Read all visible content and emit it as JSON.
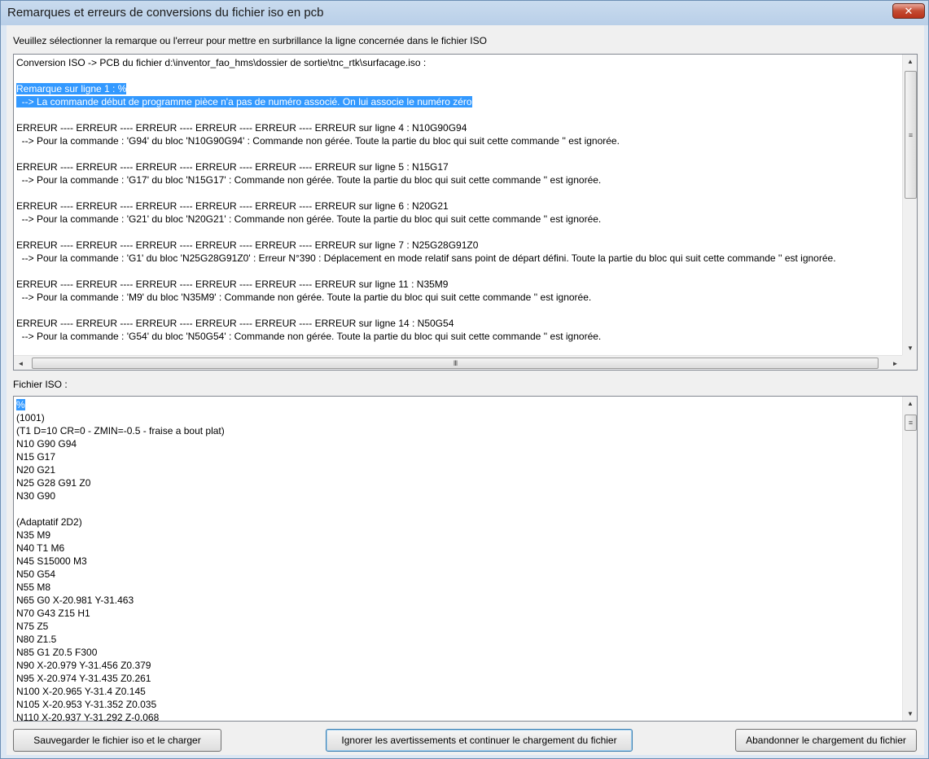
{
  "window": {
    "title": "Remarques et erreurs de conversions du fichier iso en pcb",
    "close_glyph": "✕"
  },
  "instruction": "Veuillez sélectionner la remarque ou l'erreur pour mettre en surbrillance la ligne concernée dans le fichier ISO",
  "messages": {
    "lines": [
      "Conversion ISO -> PCB du fichier d:\\inventor_fao_hms\\dossier de sortie\\tnc_rtk\\surfacage.iso :",
      "",
      "Remarque sur ligne 1 : %",
      "  --> La commande début de programme pièce n'a pas de numéro associé. On lui associe le numéro zéro",
      "",
      "ERREUR ---- ERREUR ---- ERREUR ---- ERREUR ---- ERREUR ---- ERREUR sur ligne 4 : N10G90G94",
      "  --> Pour la commande : 'G94' du bloc 'N10G90G94' : Commande non gérée. Toute la partie du bloc qui suit cette commande '' est ignorée.",
      "",
      "ERREUR ---- ERREUR ---- ERREUR ---- ERREUR ---- ERREUR ---- ERREUR sur ligne 5 : N15G17",
      "  --> Pour la commande : 'G17' du bloc 'N15G17' : Commande non gérée. Toute la partie du bloc qui suit cette commande '' est ignorée.",
      "",
      "ERREUR ---- ERREUR ---- ERREUR ---- ERREUR ---- ERREUR ---- ERREUR sur ligne 6 : N20G21",
      "  --> Pour la commande : 'G21' du bloc 'N20G21' : Commande non gérée. Toute la partie du bloc qui suit cette commande '' est ignorée.",
      "",
      "ERREUR ---- ERREUR ---- ERREUR ---- ERREUR ---- ERREUR ---- ERREUR sur ligne 7 : N25G28G91Z0",
      "  --> Pour la commande : 'G1' du bloc 'N25G28G91Z0' : Erreur N°390 : Déplacement en mode relatif sans point de départ défini. Toute la partie du bloc qui suit cette commande '' est ignorée.",
      "",
      "ERREUR ---- ERREUR ---- ERREUR ---- ERREUR ---- ERREUR ---- ERREUR sur ligne 11 : N35M9",
      "  --> Pour la commande : 'M9' du bloc 'N35M9' : Commande non gérée. Toute la partie du bloc qui suit cette commande '' est ignorée.",
      "",
      "ERREUR ---- ERREUR ---- ERREUR ---- ERREUR ---- ERREUR ---- ERREUR sur ligne 14 : N50G54",
      "  --> Pour la commande : 'G54' du bloc 'N50G54' : Commande non gérée. Toute la partie du bloc qui suit cette commande '' est ignorée."
    ],
    "selected": [
      2,
      3
    ]
  },
  "iso_label": "Fichier ISO :",
  "iso": {
    "lines": [
      "%",
      "(1001)",
      "(T1 D=10 CR=0 - ZMIN=-0.5 - fraise a bout plat)",
      "N10 G90 G94",
      "N15 G17",
      "N20 G21",
      "N25 G28 G91 Z0",
      "N30 G90",
      "",
      "(Adaptatif 2D2)",
      "N35 M9",
      "N40 T1 M6",
      "N45 S15000 M3",
      "N50 G54",
      "N55 M8",
      "N65 G0 X-20.981 Y-31.463",
      "N70 G43 Z15 H1",
      "N75 Z5",
      "N80 Z1.5",
      "N85 G1 Z0.5 F300",
      "N90 X-20.979 Y-31.456 Z0.379",
      "N95 X-20.974 Y-31.435 Z0.261",
      "N100 X-20.965 Y-31.4 Z0.145",
      "N105 X-20.953 Y-31.352 Z0.035",
      "N110 X-20.937 Y-31.292 Z-0.068"
    ],
    "selected": [
      0
    ]
  },
  "scroll": {
    "up": "▲",
    "down": "▼",
    "left": "◄",
    "right": "►",
    "grip_v": "≡",
    "grip_h": "III"
  },
  "buttons": {
    "save": "Sauvegarder le fichier iso et le charger",
    "ignore": "Ignorer les avertissements et continuer le chargement du fichier",
    "abort": "Abandonner le chargement du fichier"
  }
}
